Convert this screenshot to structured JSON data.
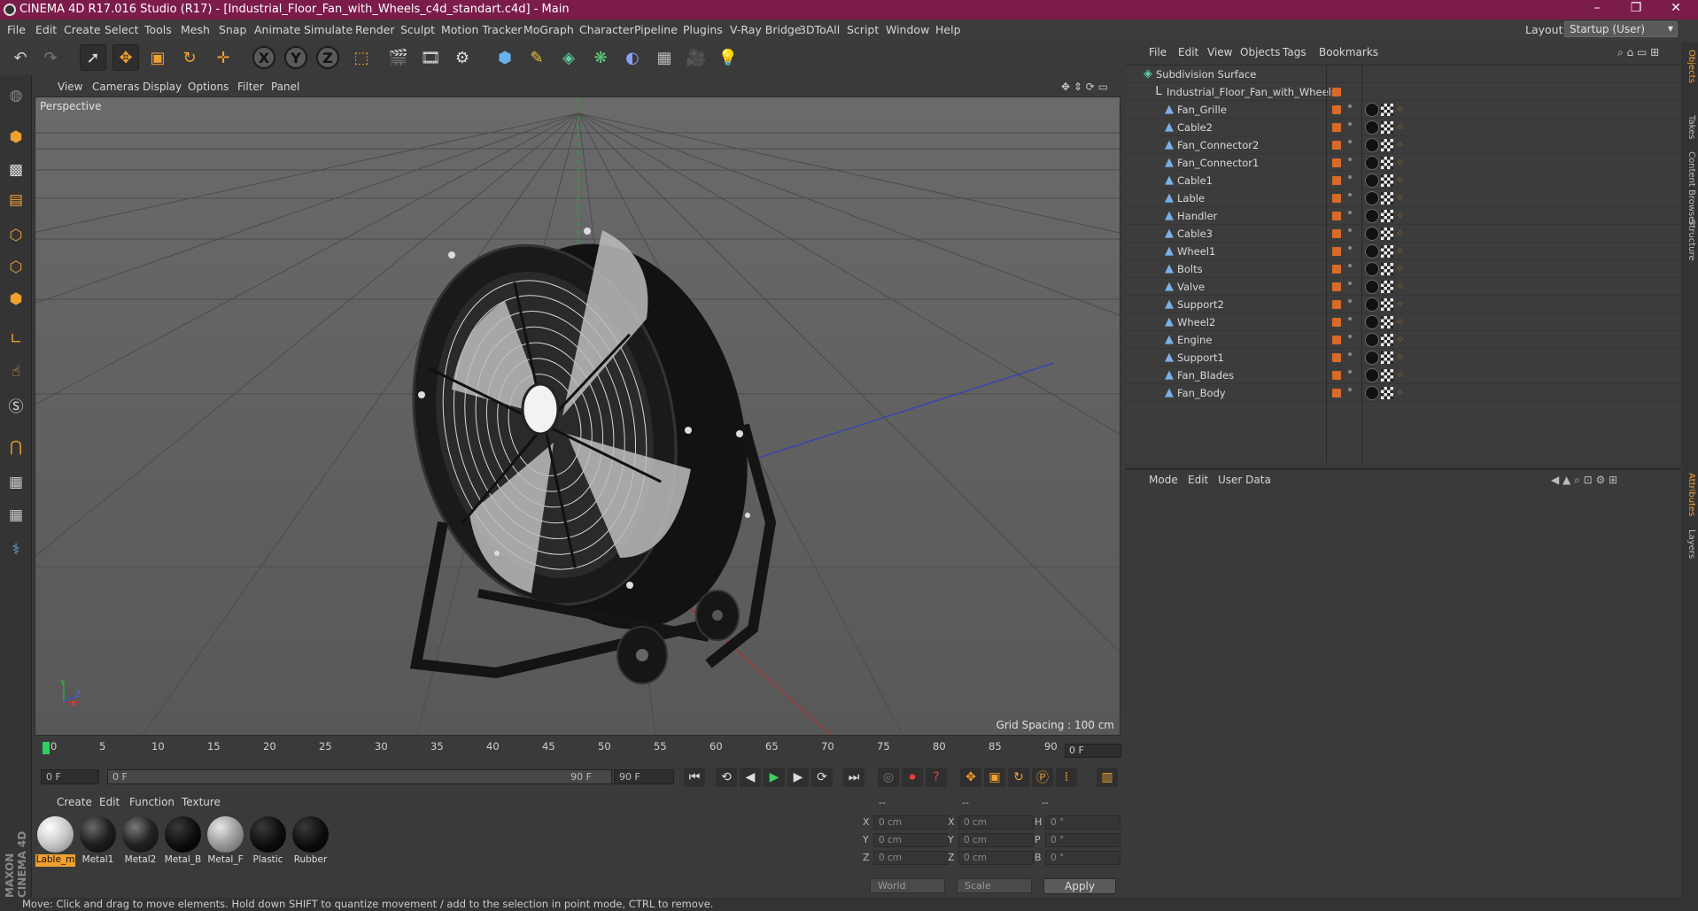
{
  "window": {
    "title": "CINEMA 4D R17.016 Studio (R17) - [Industrial_Floor_Fan_with_Wheels_c4d_standart.c4d] - Main",
    "controls": [
      "–",
      "❐",
      "✕"
    ]
  },
  "menubar": {
    "items": [
      "File",
      "Edit",
      "Create",
      "Select",
      "Tools",
      "Mesh",
      "Snap",
      "Animate",
      "Simulate",
      "Render",
      "Sculpt",
      "Motion Tracker",
      "MoGraph",
      "Character",
      "Pipeline",
      "Plugins",
      "V-Ray Bridge",
      "3DToAll",
      "Script",
      "Window",
      "Help"
    ],
    "layout_label": "Layout:",
    "layout_value": "Startup (User)"
  },
  "toolbar": {
    "axis_buttons": [
      "X",
      "Y",
      "Z"
    ]
  },
  "viewport": {
    "menu": [
      "View",
      "Cameras",
      "Display",
      "Options",
      "Filter",
      "Panel"
    ],
    "label": "Perspective",
    "grid_spacing": "Grid Spacing : 100 cm",
    "axis_labels": [
      "Y",
      "Z",
      "X"
    ]
  },
  "timeline": {
    "ticks": [
      "0",
      "5",
      "10",
      "15",
      "20",
      "25",
      "30",
      "35",
      "40",
      "45",
      "50",
      "55",
      "60",
      "65",
      "70",
      "75",
      "80",
      "85",
      "90"
    ],
    "current_frame": "0 F",
    "start_field": "0 F",
    "range_start": "0 F",
    "range_end": "90 F",
    "end_field": "90 F"
  },
  "materials": {
    "menu": [
      "Create",
      "Edit",
      "Function",
      "Texture"
    ],
    "items": [
      {
        "name": "Lable_m",
        "style": "white",
        "selected": true
      },
      {
        "name": "Metal1",
        "style": "dark"
      },
      {
        "name": "Metal2",
        "style": "dark"
      },
      {
        "name": "Metal_B",
        "style": "black"
      },
      {
        "name": "Metal_F",
        "style": "silver"
      },
      {
        "name": "Plastic",
        "style": "black"
      },
      {
        "name": "Rubber",
        "style": "black"
      }
    ],
    "brand": "MAXON CINEMA 4D"
  },
  "coordinates": {
    "headers": [
      "--",
      "--",
      "--"
    ],
    "rows": [
      {
        "a": "X",
        "av": "0 cm",
        "b": "X",
        "bv": "0 cm",
        "c": "H",
        "cv": "0 °"
      },
      {
        "a": "Y",
        "av": "0 cm",
        "b": "Y",
        "bv": "0 cm",
        "c": "P",
        "cv": "0 °"
      },
      {
        "a": "Z",
        "av": "0 cm",
        "b": "Z",
        "bv": "0 cm",
        "c": "B",
        "cv": "0 °"
      }
    ],
    "mode1": "World",
    "mode2": "Scale",
    "apply": "Apply"
  },
  "status": "Move: Click and drag to move elements. Hold down SHIFT to quantize movement / add to the selection in point mode, CTRL to remove.",
  "object_manager": {
    "menu": [
      "File",
      "Edit",
      "View",
      "Objects",
      "Tags",
      "Bookmarks"
    ],
    "root": "Subdivision Surface",
    "group": "Industrial_Floor_Fan_with_Wheels",
    "objects": [
      "Fan_Grille",
      "Cable2",
      "Fan_Connector2",
      "Fan_Connector1",
      "Cable1",
      "Lable",
      "Handler",
      "Cable3",
      "Wheel1",
      "Bolts",
      "Valve",
      "Support2",
      "Wheel2",
      "Engine",
      "Support1",
      "Fan_Blades",
      "Fan_Body"
    ]
  },
  "attribute_manager": {
    "menu": [
      "Mode",
      "Edit",
      "User Data"
    ]
  },
  "right_tabs": [
    "Objects",
    "Takes",
    "Content Browser",
    "Structure",
    "Attributes",
    "Layers"
  ],
  "colors": {
    "titlebar": "#7b1c4a",
    "accent": "#f0a030",
    "viewport_bg": "#5d5d5d"
  }
}
